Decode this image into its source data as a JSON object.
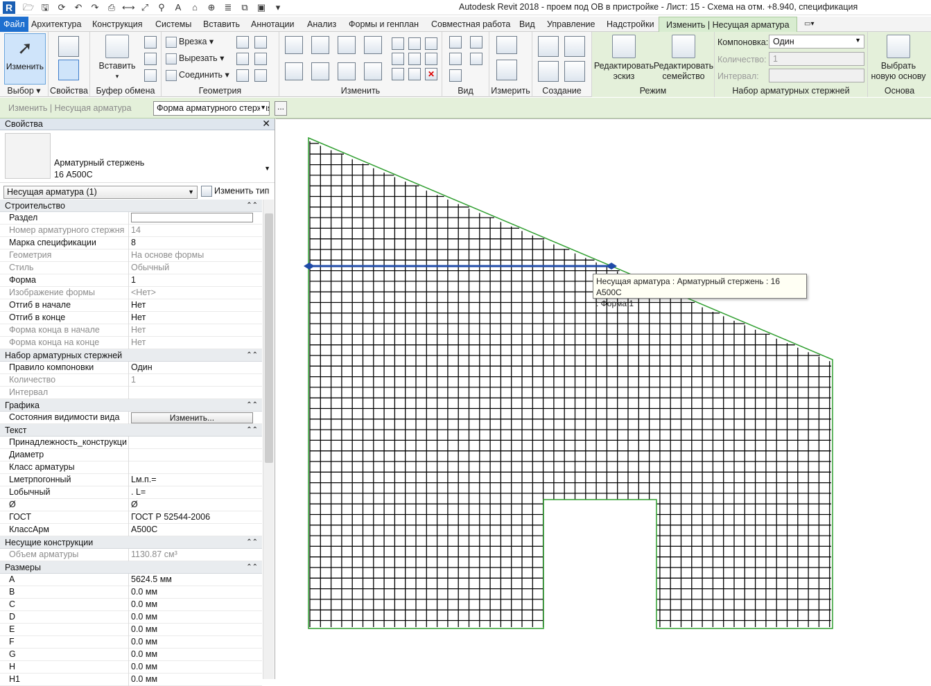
{
  "title": "Autodesk Revit 2018 -     проем под ОВ в пристройке - Лист: 15 - Схема на отм. +8.940, спецификация",
  "tabs": {
    "file": "Файл",
    "items": [
      "Архитектура",
      "Конструкция",
      "Системы",
      "Вставить",
      "Аннотации",
      "Анализ",
      "Формы и генплан",
      "Совместная работа",
      "Вид",
      "Управление",
      "Надстройки"
    ],
    "active": "Изменить | Несущая арматура"
  },
  "ribbon": {
    "modify": "Изменить",
    "paste": "Вставить",
    "cut_label": "Врезка",
    "cutout_label": "Вырезать",
    "join_label": "Соединить",
    "edit_sketch": [
      "Редактировать",
      "эскиз"
    ],
    "edit_family": [
      "Редактировать",
      "семейство"
    ],
    "select_host": [
      "Выбрать",
      "новую основу"
    ],
    "layout_label": "Компоновка:",
    "layout_value": "Один",
    "count_label": "Количество:",
    "count_value": "1",
    "interval_label": "Интервал:",
    "panels": {
      "select": "Выбор",
      "properties": "Свойства",
      "clipboard": "Буфер обмена",
      "geometry": "Геометрия",
      "modify": "Изменить",
      "view": "Вид",
      "measure": "Измерить",
      "create": "Создание",
      "mode": "Режим",
      "rebarset": "Набор арматурных стержней",
      "host": "Основа"
    }
  },
  "options_bar": {
    "context": "Изменить | Несущая арматура",
    "shape_select": "Форма арматурного стержня",
    "more": "..."
  },
  "properties": {
    "title": "Свойства",
    "type_name_1": "Арматурный стержень",
    "type_name_2": "16 А500С",
    "instance": "Несущая арматура (1)",
    "edit_type": "Изменить тип",
    "groups": {
      "construction": "Строительство",
      "rebarset": "Набор арматурных стержней",
      "graphics": "Графика",
      "text": "Текст",
      "structural": "Несущие конструкции",
      "dimensions": "Размеры"
    },
    "construction_rows": [
      {
        "k": "Раздел",
        "v": ""
      },
      {
        "k": "Номер арматурного стержня",
        "v": "14"
      },
      {
        "k": "Марка спецификации",
        "v": "8"
      },
      {
        "k": "Геометрия",
        "v": "На основе формы"
      },
      {
        "k": "Стиль",
        "v": "Обычный"
      },
      {
        "k": "Форма",
        "v": "1"
      },
      {
        "k": "Изображение формы",
        "v": "<Нет>"
      },
      {
        "k": "Отгиб в начале",
        "v": "Нет"
      },
      {
        "k": "Отгиб в конце",
        "v": "Нет"
      },
      {
        "k": "Форма конца в начале",
        "v": "Нет"
      },
      {
        "k": "Форма конца на конце",
        "v": "Нет"
      }
    ],
    "rebarset_rows": [
      {
        "k": "Правило компоновки",
        "v": "Один"
      },
      {
        "k": "Количество",
        "v": "1"
      },
      {
        "k": "Интервал",
        "v": ""
      }
    ],
    "graphics_rows": [
      {
        "k": "Состояния видимости вида",
        "v": "Изменить..."
      }
    ],
    "text_rows": [
      {
        "k": "Принадлежность_конструкции",
        "v": ""
      },
      {
        "k": "Диаметр",
        "v": ""
      },
      {
        "k": "Класс арматуры",
        "v": ""
      },
      {
        "k": "Lметрпогонный",
        "v": "Lм.п.="
      },
      {
        "k": "Lобычный",
        "v": ".     L="
      },
      {
        "k": "Ø",
        "v": "Ø"
      },
      {
        "k": "ГОСТ",
        "v": "ГОСТ Р 52544-2006"
      },
      {
        "k": "КлассАрм",
        "v": "А500С"
      }
    ],
    "structural_rows": [
      {
        "k": "Объем арматуры",
        "v": "1130.87 см³"
      }
    ],
    "dimension_rows": [
      {
        "k": "A",
        "v": "5624.5 мм"
      },
      {
        "k": "B",
        "v": "0.0 мм"
      },
      {
        "k": "C",
        "v": "0.0 мм"
      },
      {
        "k": "D",
        "v": "0.0 мм"
      },
      {
        "k": "E",
        "v": "0.0 мм"
      },
      {
        "k": "F",
        "v": "0.0 мм"
      },
      {
        "k": "G",
        "v": "0.0 мм"
      },
      {
        "k": "H",
        "v": "0.0 мм"
      },
      {
        "k": "H1",
        "v": "0.0 мм"
      }
    ]
  },
  "canvas": {
    "tooltip_line1": "Несущая арматура : Арматурный стержень : 16 А500С",
    "tooltip_line2": ": Форма 1",
    "colors": {
      "outline": "#2f9e2f",
      "mesh": "#000000",
      "selected": "#1f4aa8"
    }
  }
}
